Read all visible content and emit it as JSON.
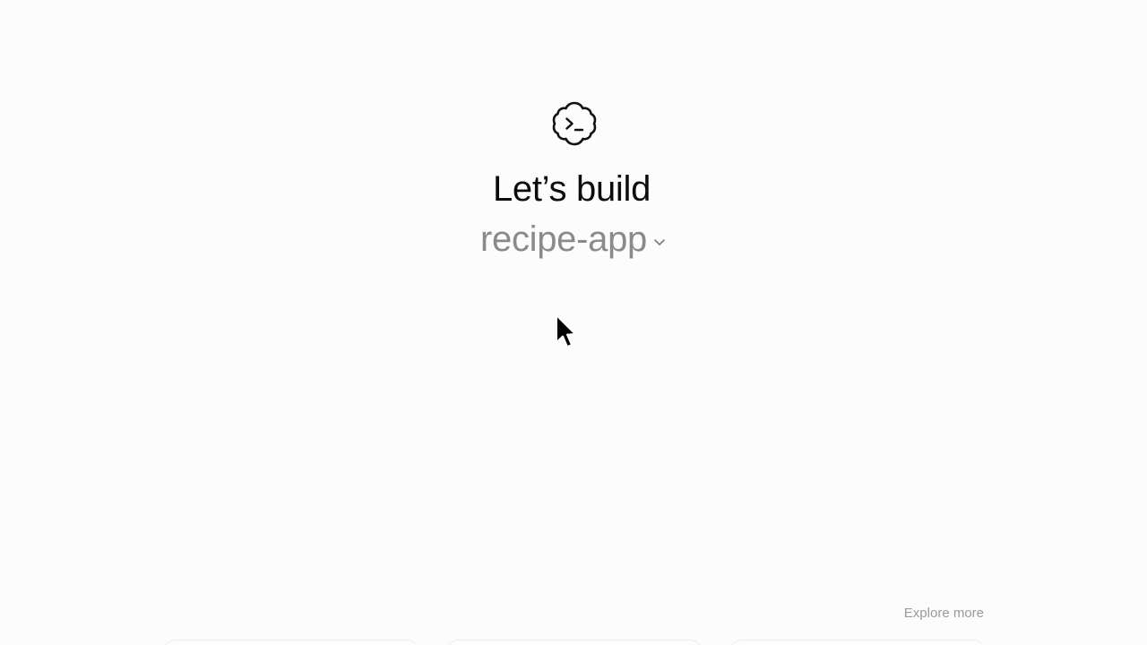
{
  "hero": {
    "headline": "Let’s build",
    "project_name": "recipe-app"
  },
  "icons": {
    "logo": "terminal-cloud-icon",
    "project_picker": "chevron-down-icon",
    "cursor": "mouse-pointer-icon"
  },
  "footer": {
    "explore_more": "Explore more"
  },
  "colors": {
    "background": "#fcfcfc",
    "headline": "#0d0d0d",
    "muted": "#8a8a8a"
  }
}
